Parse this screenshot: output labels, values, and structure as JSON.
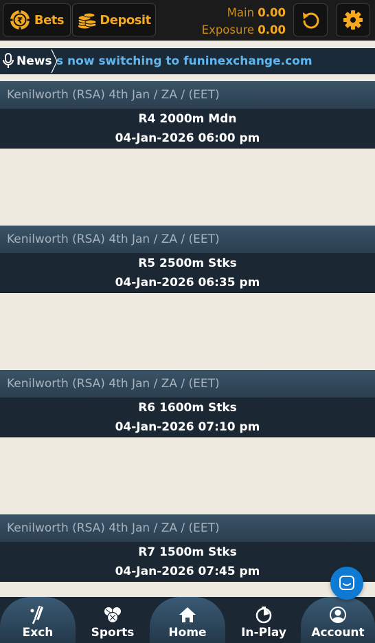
{
  "header": {
    "bets_label": "Bets",
    "deposit_label": "Deposit",
    "main_label": "Main",
    "main_value": "0.00",
    "exposure_label": "Exposure",
    "exposure_value": "0.00"
  },
  "news": {
    "label": "News",
    "ticker": "s now switching to funinexchange.com"
  },
  "races": [
    {
      "venue": "Kenilworth (RSA) 4th Jan / ZA / (EET)",
      "name": "R4 2000m Mdn",
      "time": "04-Jan-2026 06:00 pm"
    },
    {
      "venue": "Kenilworth (RSA) 4th Jan / ZA / (EET)",
      "name": "R5 2500m Stks",
      "time": "04-Jan-2026 06:35 pm"
    },
    {
      "venue": "Kenilworth (RSA) 4th Jan / ZA / (EET)",
      "name": "R6 1600m Stks",
      "time": "04-Jan-2026 07:10 pm"
    },
    {
      "venue": "Kenilworth (RSA) 4th Jan / ZA / (EET)",
      "name": "R7 1500m Stks",
      "time": "04-Jan-2026 07:45 pm"
    }
  ],
  "nav": {
    "exch": "Exch",
    "sports": "Sports",
    "home": "Home",
    "inplay": "In-Play",
    "account": "Account"
  },
  "colors": {
    "accent": "#f4a81d",
    "ticker": "#5db6ef",
    "panel": "#1b2834",
    "background": "#eeeae0"
  }
}
